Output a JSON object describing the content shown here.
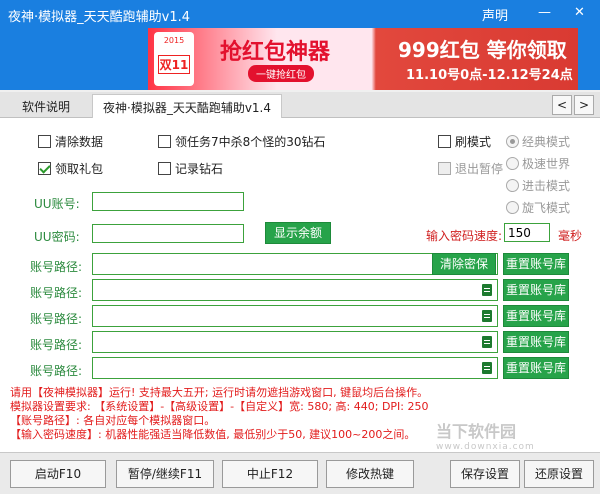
{
  "window": {
    "title": "夜神·模拟器_天天酷跑辅助v1.4",
    "statement": "声明",
    "minimize": "—",
    "close": "✕"
  },
  "banner": {
    "logo_year": "2015",
    "logo_badge": "双11",
    "main_text": "抢红包神器",
    "sub_button": "一键抢红包",
    "promo_text": "999红包 等你领取",
    "date_text": "11.10号0点-12.12号24点"
  },
  "tabs": [
    {
      "label": "软件说明"
    },
    {
      "label": "夜神·模拟器_天天酷跑辅助v1.4"
    }
  ],
  "nav": {
    "prev": "<",
    "next": ">"
  },
  "options": {
    "clear_data": {
      "label": "清除数据",
      "checked": false
    },
    "claim_gift": {
      "label": "领取礼包",
      "checked": true
    },
    "task_30_diamonds": {
      "label": "领任务7中杀8个怪的30钻石",
      "checked": false
    },
    "record_diamonds": {
      "label": "记录钻石",
      "checked": false
    },
    "grind_mode": {
      "label": "刷模式",
      "checked": false
    },
    "exit_pause": {
      "label": "退出暂停",
      "checked": false
    }
  },
  "modes": [
    {
      "label": "经典模式",
      "selected": true
    },
    {
      "label": "极速世界",
      "selected": false
    },
    {
      "label": "进击模式",
      "selected": false
    },
    {
      "label": "旋飞模式",
      "selected": false
    }
  ],
  "form": {
    "uu_account_label": "UU账号:",
    "uu_account_value": "",
    "uu_password_label": "UU密码:",
    "uu_password_value": "",
    "show_balance": "显示余额",
    "speed_label": "输入密码速度:",
    "speed_value": "150",
    "speed_unit": "毫秒",
    "path_label": "账号路径:",
    "clear_secret": "清除密保",
    "reset_account": "重置账号库"
  },
  "account_paths": [
    {
      "label": "账号路径:",
      "value": ""
    },
    {
      "label": "账号路径:",
      "value": ""
    },
    {
      "label": "账号路径:",
      "value": ""
    },
    {
      "label": "账号路径:",
      "value": ""
    },
    {
      "label": "账号路径:",
      "value": ""
    }
  ],
  "notes": [
    "请用【夜神模拟器】运行! 支持最大五开; 运行时请勿遮挡游戏窗口, 键鼠均后台操作。",
    "模拟器设置要求: 【系统设置】-【高级设置】-【自定义】宽: 580; 高: 440; DPI: 250",
    "【账号路径】: 各自对应每个模拟器窗口。",
    "【输入密码速度】: 机器性能强适当降低数值, 最低别少于50, 建议100~200之间。"
  ],
  "footer": {
    "start": "启动F10",
    "pause": "暂停/继续F11",
    "stop": "中止F12",
    "hotkey": "修改热键",
    "save": "保存设置",
    "restore": "还原设置"
  },
  "watermark": {
    "text": "当下软件园",
    "sub": "www.downxia.com"
  },
  "colors": {
    "title_blue": "#1a7fe0",
    "accent_green": "#27a34a",
    "note_red": "#e21b1b"
  }
}
